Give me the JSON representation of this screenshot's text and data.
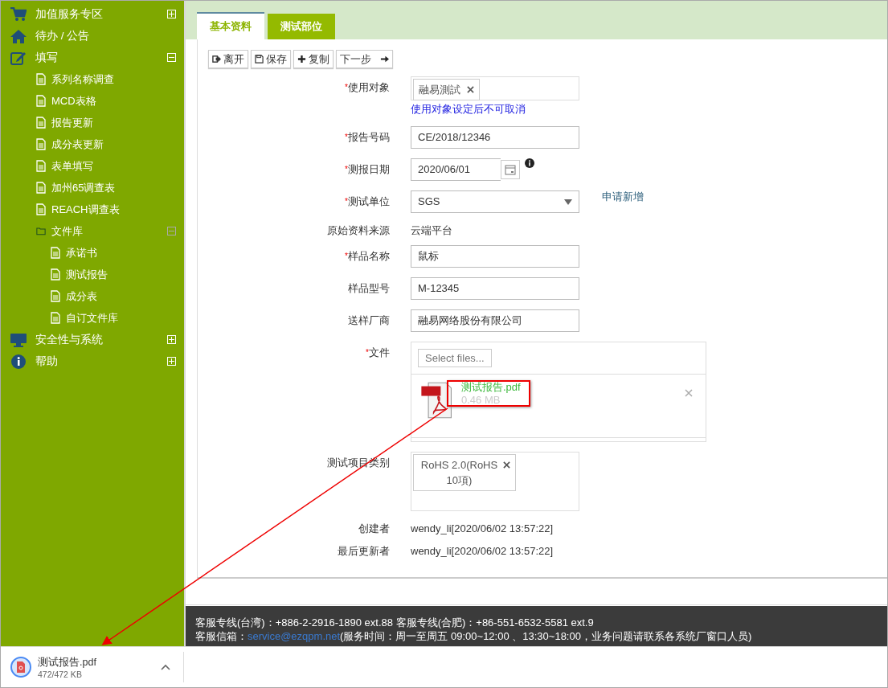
{
  "sidebar": {
    "items": [
      {
        "label": "加值服务专区",
        "kind": "cart",
        "expanded": false
      },
      {
        "label": "待办 / 公告",
        "kind": "home"
      },
      {
        "label": "填写",
        "kind": "edit",
        "expanded": true,
        "children": [
          {
            "label": "系列名称调查",
            "kind": "doc"
          },
          {
            "label": "MCD表格",
            "kind": "doc"
          },
          {
            "label": "报告更新",
            "kind": "doc"
          },
          {
            "label": "成分表更新",
            "kind": "doc"
          },
          {
            "label": "表单填写",
            "kind": "doc"
          },
          {
            "label": "加州65调查表",
            "kind": "doc"
          },
          {
            "label": "REACH调查表",
            "kind": "doc"
          },
          {
            "label": "文件库",
            "kind": "folder",
            "expanded": true,
            "children": [
              {
                "label": "承诺书",
                "kind": "doc"
              },
              {
                "label": "测试报告",
                "kind": "doc"
              },
              {
                "label": "成分表",
                "kind": "doc"
              },
              {
                "label": "自订文件库",
                "kind": "doc"
              }
            ]
          }
        ]
      },
      {
        "label": "安全性与系统",
        "kind": "monitor",
        "expanded": false
      },
      {
        "label": "帮助",
        "kind": "info",
        "expanded": false
      }
    ]
  },
  "tabs": [
    {
      "label": "基本资料",
      "selected": true
    },
    {
      "label": "测试部位",
      "selected": false
    }
  ],
  "toolbar": [
    {
      "label": "离开",
      "kind": "exit"
    },
    {
      "label": "保存",
      "kind": "save"
    },
    {
      "label": "复制",
      "kind": "plus"
    },
    {
      "label": "下一步",
      "kind": "next"
    }
  ],
  "form": [
    {
      "kind": "tag",
      "required_mark": "*",
      "label": "使用对象",
      "tags": [
        "融易測試"
      ],
      "note": "使用对象设定后不可取消"
    },
    {
      "kind": "text",
      "required_mark": "*",
      "label": "报告号码",
      "value": "CE/2018/12346"
    },
    {
      "kind": "date",
      "required_mark": "*",
      "label": "测报日期",
      "value": "2020/06/01"
    },
    {
      "kind": "select",
      "required_mark": "*",
      "label": "测试单位",
      "value": "SGS",
      "link": "申请新增"
    },
    {
      "kind": "static",
      "label": "原始资料来源",
      "value": "云端平台"
    },
    {
      "kind": "text",
      "required_mark": "*",
      "label": "样品名称",
      "value": "鼠标"
    },
    {
      "kind": "text",
      "label": "样品型号",
      "value": "M-12345"
    },
    {
      "kind": "text",
      "label": "送样厂商",
      "value": "融易网络股份有限公司"
    },
    {
      "kind": "file",
      "required_mark": "*",
      "label": "文件",
      "button": "Select files...",
      "file_name": "测试报告.pdf",
      "file_size": "0.46 MB"
    },
    {
      "kind": "tags",
      "label": "测试项目类别",
      "tags": [
        "RoHS 2.0(RoHS 10項)"
      ]
    },
    {
      "kind": "static",
      "label": "创建者",
      "value": "wendy_li[2020/06/02 13:57:22]"
    },
    {
      "kind": "static",
      "label": "最后更新者",
      "value": "wendy_li[2020/06/02 13:57:22]"
    }
  ],
  "footer": {
    "line_1": "客服专线(台湾)：+886-2-2916-1890 ext.88 客服专线(合肥)：+86-551-6532-5581 ext.9",
    "line_2_before": "客服信箱：",
    "email": "service@ezqpm.net",
    "line_2_after": "(服务时间：周一至周五 09:00~12:00 、13:30~18:00，业务问题请联系各系统厂窗口人员)"
  },
  "download_bar": {
    "file_name": "测试报告.pdf",
    "progress": "472/472 KB",
    "level": 1
  }
}
